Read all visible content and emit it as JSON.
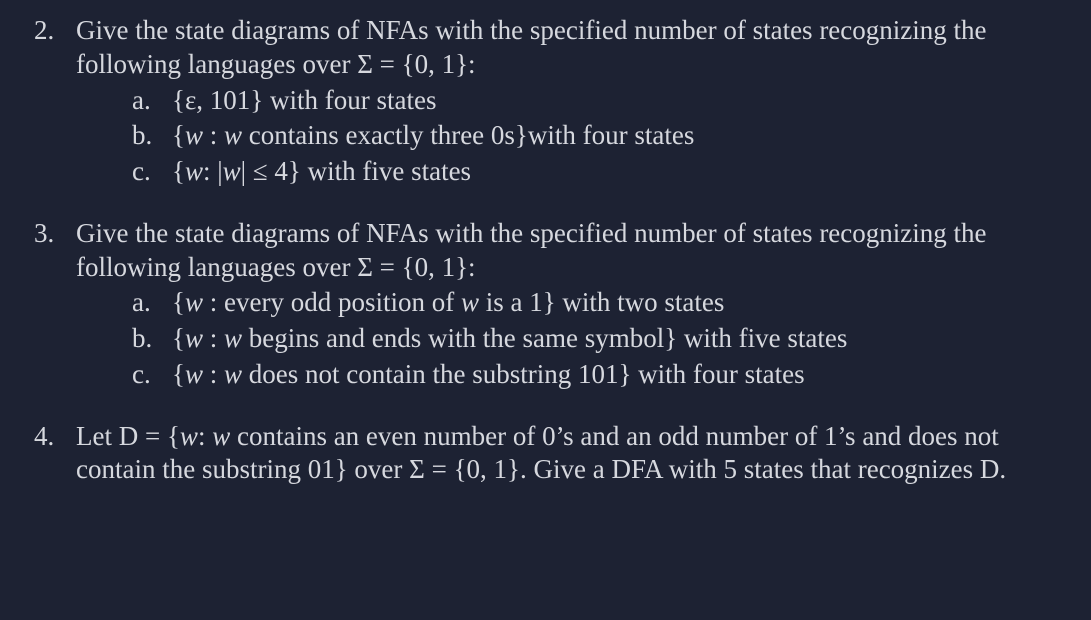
{
  "q2": {
    "number": "2.",
    "intro_a": "Give the state diagrams of NFAs with the specified number of states recognizing the following languages over ",
    "intro_b": "Σ = {0, 1}:",
    "a_label": "a.",
    "a_text": "{ε, 101} with four states",
    "b_label": "b.",
    "b_pre": "{",
    "b_var": "w",
    "b_mid": " : ",
    "b_var2": "w",
    "b_rest": " contains exactly three 0s}with four states",
    "c_label": "c.",
    "c_pre": "{",
    "c_var": "w",
    "c_mid": ": |",
    "c_var2": "w",
    "c_rest": "| ≤ 4} with five states"
  },
  "q3": {
    "number": "3.",
    "intro_a": "Give the state diagrams of NFAs with the specified number of states recognizing the following languages over ",
    "intro_b": "Σ = {0, 1}:",
    "a_label": "a.",
    "a_pre": "{",
    "a_var": "w",
    "a_mid": " : every odd position of ",
    "a_var2": "w",
    "a_rest": " is a 1} with two states",
    "b_label": "b.",
    "b_pre": "{",
    "b_var": "w",
    "b_mid": " : ",
    "b_var2": "w",
    "b_rest": " begins and ends with the same symbol} with five states",
    "c_label": "c.",
    "c_pre": "{",
    "c_var": "w",
    "c_mid": " : ",
    "c_var2": "w",
    "c_rest": " does not contain the substring 101} with four states"
  },
  "q4": {
    "number": "4.",
    "pre": "Let D = {",
    "var": "w",
    "mid": ": ",
    "var2": "w",
    "rest": " contains an even number of 0’s and an odd number of 1’s and does not contain the substring 01} over Σ = {0, 1}. Give a DFA with 5 states that recognizes D."
  }
}
